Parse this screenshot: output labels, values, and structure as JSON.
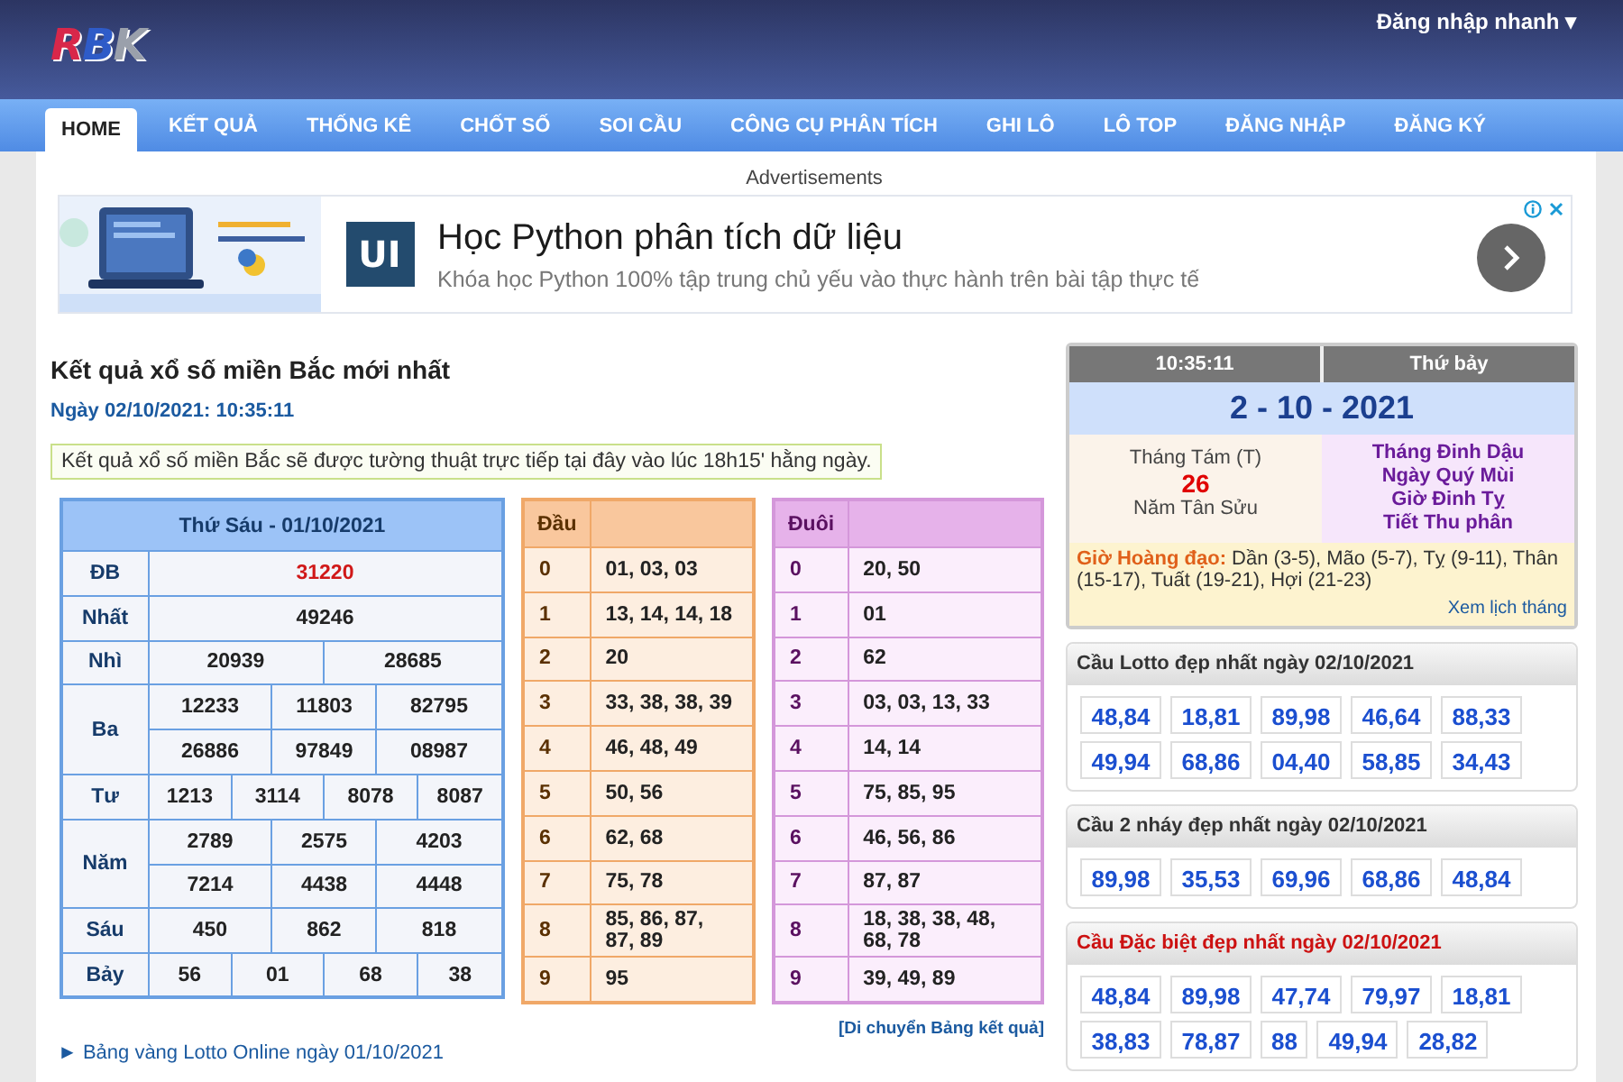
{
  "header": {
    "logo": "RBK",
    "login_menu": "Đăng nhập nhanh ▾"
  },
  "nav": [
    {
      "label": "HOME",
      "selected": true
    },
    {
      "label": "KẾT QUẢ",
      "selected": false
    },
    {
      "label": "THỐNG KÊ",
      "selected": false
    },
    {
      "label": "CHỐT SỐ",
      "selected": false
    },
    {
      "label": "SOI CẦU",
      "selected": false
    },
    {
      "label": "CÔNG CỤ PHÂN TÍCH",
      "selected": false
    },
    {
      "label": "GHI LÔ",
      "selected": false
    },
    {
      "label": "LÔ TOP",
      "selected": false
    },
    {
      "label": "ĐĂNG NHẬP",
      "selected": false
    },
    {
      "label": "ĐĂNG KÝ",
      "selected": false
    }
  ],
  "ad": {
    "caption": "Advertisements",
    "logo": "UI",
    "title": "Học Python phân tích dữ liệu",
    "subtitle": "Khóa học Python 100% tập trung chủ yếu vào thực hành trên bài tập thực tế"
  },
  "main": {
    "title": "Kết quả xổ số miền Bắc mới nhất",
    "date": "Ngày 02/10/2021: 10:35:11",
    "notice": "Kết quả xổ số miền Bắc sẽ được tường thuật trực tiếp tại đây vào lúc 18h15' hằng ngày.",
    "move_link": "[Di chuyển Bảng kết quả]",
    "bottom_link": "► Bảng vàng Lotto Online ngày 01/10/2021"
  },
  "results": {
    "title": "Thứ Sáu - 01/10/2021",
    "rows": [
      {
        "label": "ĐB",
        "special": true,
        "lines": [
          [
            "31220"
          ]
        ]
      },
      {
        "label": "Nhất",
        "special": false,
        "lines": [
          [
            "49246"
          ]
        ]
      },
      {
        "label": "Nhì",
        "special": false,
        "lines": [
          [
            "20939",
            "28685"
          ]
        ]
      },
      {
        "label": "Ba",
        "special": false,
        "lines": [
          [
            "12233",
            "11803",
            "82795"
          ],
          [
            "26886",
            "97849",
            "08987"
          ]
        ]
      },
      {
        "label": "Tư",
        "special": false,
        "lines": [
          [
            "1213",
            "3114",
            "8078",
            "8087"
          ]
        ]
      },
      {
        "label": "Năm",
        "special": false,
        "lines": [
          [
            "2789",
            "2575",
            "4203"
          ],
          [
            "7214",
            "4438",
            "4448"
          ]
        ]
      },
      {
        "label": "Sáu",
        "special": false,
        "lines": [
          [
            "450",
            "862",
            "818"
          ]
        ]
      },
      {
        "label": "Bảy",
        "special": false,
        "lines": [
          [
            "56",
            "01",
            "68",
            "38"
          ]
        ]
      }
    ]
  },
  "loto_tables": [
    {
      "kind": "head",
      "title": "Đầu",
      "rows": [
        {
          "digit": "0",
          "values": "01, 03, 03"
        },
        {
          "digit": "1",
          "values": "13, 14, 14, 18"
        },
        {
          "digit": "2",
          "values": "20"
        },
        {
          "digit": "3",
          "values": "33, 38, 38, 39"
        },
        {
          "digit": "4",
          "values": "46, 48, 49"
        },
        {
          "digit": "5",
          "values": "50, 56"
        },
        {
          "digit": "6",
          "values": "62, 68"
        },
        {
          "digit": "7",
          "values": "75, 78"
        },
        {
          "digit": "8",
          "values": "85, 86, 87, 87, 89"
        },
        {
          "digit": "9",
          "values": "95"
        }
      ]
    },
    {
      "kind": "tail",
      "title": "Đuôi",
      "rows": [
        {
          "digit": "0",
          "values": "20, 50"
        },
        {
          "digit": "1",
          "values": "01"
        },
        {
          "digit": "2",
          "values": "62"
        },
        {
          "digit": "3",
          "values": "03, 03, 13, 33"
        },
        {
          "digit": "4",
          "values": "14, 14"
        },
        {
          "digit": "5",
          "values": "75, 85, 95"
        },
        {
          "digit": "6",
          "values": "46, 56, 86"
        },
        {
          "digit": "7",
          "values": "87, 87"
        },
        {
          "digit": "8",
          "values": "18, 38, 38, 48, 68, 78"
        },
        {
          "digit": "9",
          "values": "39, 49, 89"
        }
      ]
    }
  ],
  "calendar": {
    "time": "10:35:11",
    "weekday": "Thứ bảy",
    "date": "2 - 10 - 2021",
    "lunar_month": "Tháng Tám (T)",
    "lunar_day": "26",
    "lunar_year": "Năm Tân Sửu",
    "can_chi": [
      "Tháng Đinh Dậu",
      "Ngày Quý Mùi",
      "Giờ Đinh Tỵ",
      "Tiết Thu phân"
    ],
    "hoang_dao_label": "Giờ Hoàng đạo:",
    "hoang_dao": "Dần (3-5), Mão (5-7), Tỵ (9-11), Thân (15-17), Tuất (19-21), Hợi (21-23)",
    "link": "Xem lịch tháng"
  },
  "cau_boxes": [
    {
      "title": "Cầu Lotto đẹp nhất ngày 02/10/2021",
      "color": "#333333",
      "pairs": [
        "48,84",
        "18,81",
        "89,98",
        "46,64",
        "88,33",
        "49,94",
        "68,86",
        "04,40",
        "58,85",
        "34,43"
      ]
    },
    {
      "title": "Cầu 2 nháy đẹp nhất ngày 02/10/2021",
      "color": "#333333",
      "pairs": [
        "89,98",
        "35,53",
        "69,96",
        "68,86",
        "48,84"
      ]
    },
    {
      "title": "Cầu Đặc biệt đẹp nhất ngày 02/10/2021",
      "color": "#cc1111",
      "pairs": [
        "48,84",
        "89,98",
        "47,74",
        "79,97",
        "18,81",
        "38,83",
        "78,87",
        "88",
        "49,94",
        "28,82"
      ]
    }
  ]
}
